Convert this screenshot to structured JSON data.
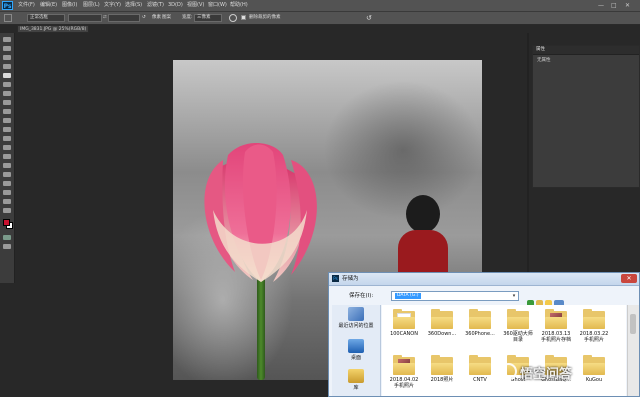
{
  "app": {
    "logo": "Ps"
  },
  "menubar": {
    "items": [
      "文件(F)",
      "编辑(E)",
      "图像(I)",
      "图层(L)",
      "文字(Y)",
      "选择(S)",
      "滤镜(T)",
      "3D(D)",
      "视图(V)",
      "窗口(W)",
      "帮助(H)"
    ]
  },
  "window_controls": {
    "minimize": "—",
    "maximize": "□",
    "close": "✕"
  },
  "options": {
    "mode_value": "正常选框",
    "width_label": "宽度:",
    "height_label": "高度:",
    "swap_icon": "⇄",
    "unit_label": "像素",
    "pixel_label": "图案",
    "mode_select": "三像素",
    "delete_cropped_label": "删除裁剪的像素",
    "reset_icon": "↺"
  },
  "document_tab": {
    "label": "IMG_3831.JPG @ 25%(RGB/8)"
  },
  "properties_panel": {
    "title": "属性",
    "subtitle": "无属性"
  },
  "save_dialog": {
    "title": "存储为",
    "close": "✕",
    "save_in_label": "保存在(I):",
    "save_in_value": "DATA (G:)",
    "places": [
      {
        "label": "最近访问的位置",
        "icon": "recent-places-icon"
      },
      {
        "label": "桌面",
        "icon": "desktop-icon"
      },
      {
        "label": "库",
        "icon": "libraries-icon"
      }
    ],
    "files": [
      {
        "name": "100CANON",
        "line2": "",
        "kind": "paper"
      },
      {
        "name": "360Down...",
        "line2": "",
        "kind": "plain"
      },
      {
        "name": "360Phone...",
        "line2": "",
        "kind": "plain"
      },
      {
        "name": "360驱动大师",
        "line2": "目录",
        "kind": "plain"
      },
      {
        "name": "2018.03.13",
        "line2": "手机照片存档",
        "kind": "photo"
      },
      {
        "name": "2018.03.22",
        "line2": "手机照片",
        "kind": "plain"
      },
      {
        "name": "2018.04.02",
        "line2": "手机照片",
        "kind": "photo"
      },
      {
        "name": "2018照片",
        "line2": "",
        "kind": "plain"
      },
      {
        "name": "CNTV",
        "line2": "",
        "kind": "plain"
      },
      {
        "name": "Ghost",
        "line2": "",
        "kind": "plain"
      },
      {
        "name": "GhostBaQ...",
        "line2": "",
        "kind": "plain"
      },
      {
        "name": "KuGou",
        "line2": "",
        "kind": "plain"
      }
    ]
  },
  "watermark": {
    "text": "悟空问答"
  },
  "colors": {
    "foreground": "#c8102e",
    "background": "#ffffff",
    "accent": "#31a8ff"
  }
}
